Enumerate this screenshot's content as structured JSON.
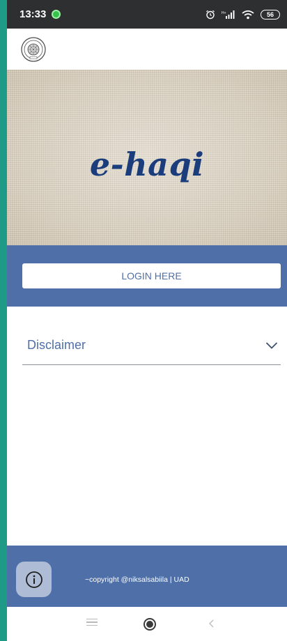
{
  "status_bar": {
    "time": "13:33",
    "battery": "56",
    "icons": [
      "alarm-icon",
      "signal-icon",
      "wifi-icon",
      "battery-icon"
    ]
  },
  "header": {
    "logo": "university-seal-logo"
  },
  "hero": {
    "title": "e-haqi"
  },
  "login": {
    "button_label": "LOGIN HERE"
  },
  "disclaimer": {
    "label": "Disclaimer",
    "icon": "chevron-down-icon"
  },
  "footer": {
    "info_icon": "info-icon",
    "copyright": "~copyright @niksalsabiila | UAD"
  },
  "nav_bar": {
    "items": [
      "menu-icon",
      "home-icon",
      "back-icon"
    ]
  },
  "colors": {
    "accent": "#4f6fa8",
    "title": "#1c3d7c",
    "frame": "#1f9a86",
    "status_bar": "#2e2f31"
  }
}
